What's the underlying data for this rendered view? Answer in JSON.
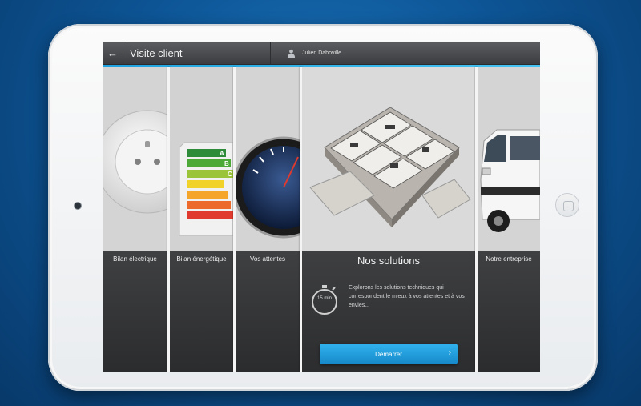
{
  "header": {
    "back_icon": "arrow-left-icon",
    "title": "Visite client",
    "user_icon": "user-icon",
    "user_name": "Julien Daboville"
  },
  "panels": [
    {
      "label": "Bilan électrique",
      "image": "electrical-outlet"
    },
    {
      "label": "Bilan énergétique",
      "image": "energy-label",
      "energy_letters": [
        "A",
        "B",
        "C"
      ]
    },
    {
      "label": "Vos attentes",
      "image": "gauge"
    },
    {
      "label": "Nos solutions",
      "image": "house-plan-3d"
    },
    {
      "label": "Notre entreprise",
      "image": "van"
    }
  ],
  "solutions": {
    "timer_icon": "stopwatch-icon",
    "timer_text": "15 min",
    "description": "Explorons les solutions techniques qui correspondent le mieux à vos attentes et à vos envies...",
    "start_label": "Démarrer",
    "start_icon": "chevron-right-icon"
  },
  "colors": {
    "accent": "#2aa9e6",
    "button": "#1e96d6",
    "background": "#0d5596"
  }
}
